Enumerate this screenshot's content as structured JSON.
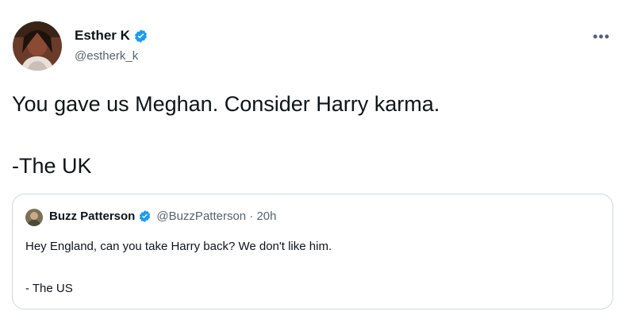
{
  "tweet": {
    "author_name": "Esther K",
    "author_handle": "@estherk_k",
    "more_icon": "more-icon",
    "text_line1": "You gave us Meghan. Consider Harry karma.",
    "text_line2": "-The UK"
  },
  "quote": {
    "author_name": "Buzz Patterson",
    "meta": "@BuzzPatterson · 20h",
    "text_line1": "Hey England, can you take Harry back? We don't like him.",
    "text_line2": "- The US"
  },
  "colors": {
    "verified": "#1d9bf0",
    "text": "#0f1419",
    "secondary": "#536471",
    "border": "#cfd9de"
  }
}
